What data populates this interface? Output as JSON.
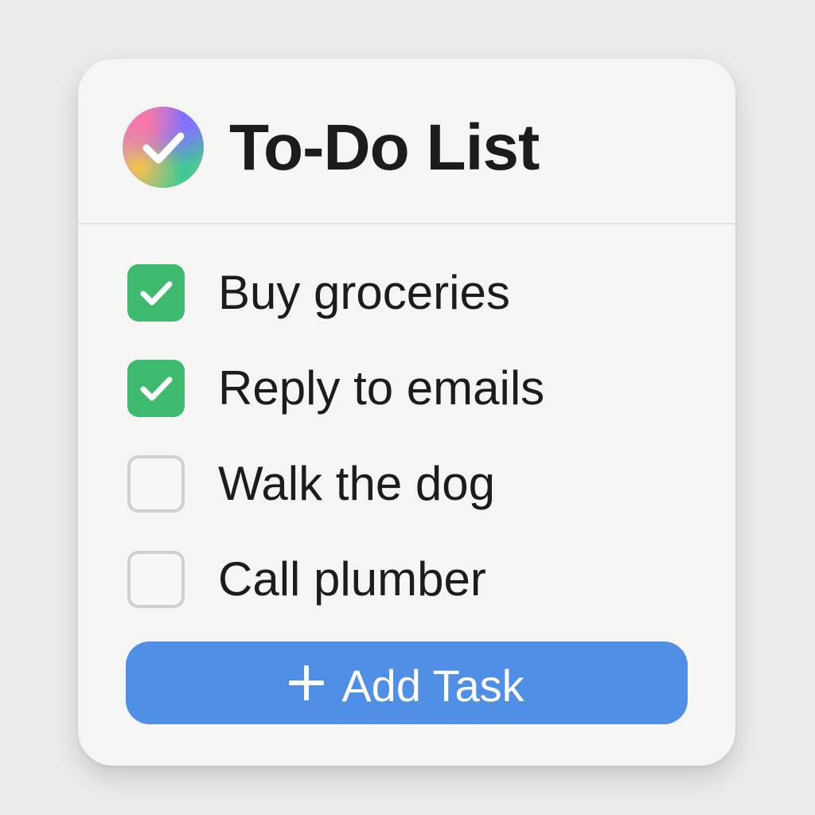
{
  "app": {
    "title": "To-Do List",
    "logo_icon": "gradient-checkmark-logo"
  },
  "tasks": [
    {
      "label": "Buy groceries",
      "checked": true
    },
    {
      "label": "Reply to emails",
      "checked": true
    },
    {
      "label": "Walk the dog",
      "checked": false
    },
    {
      "label": "Call plumber",
      "checked": false
    }
  ],
  "add_button": {
    "label": "Add Task",
    "icon": "plus-icon"
  },
  "colors": {
    "checked": "#3dba6e",
    "unchecked_border": "#cfcfcc",
    "accent_button": "#4f8fe6",
    "text": "#1c1c1c"
  }
}
